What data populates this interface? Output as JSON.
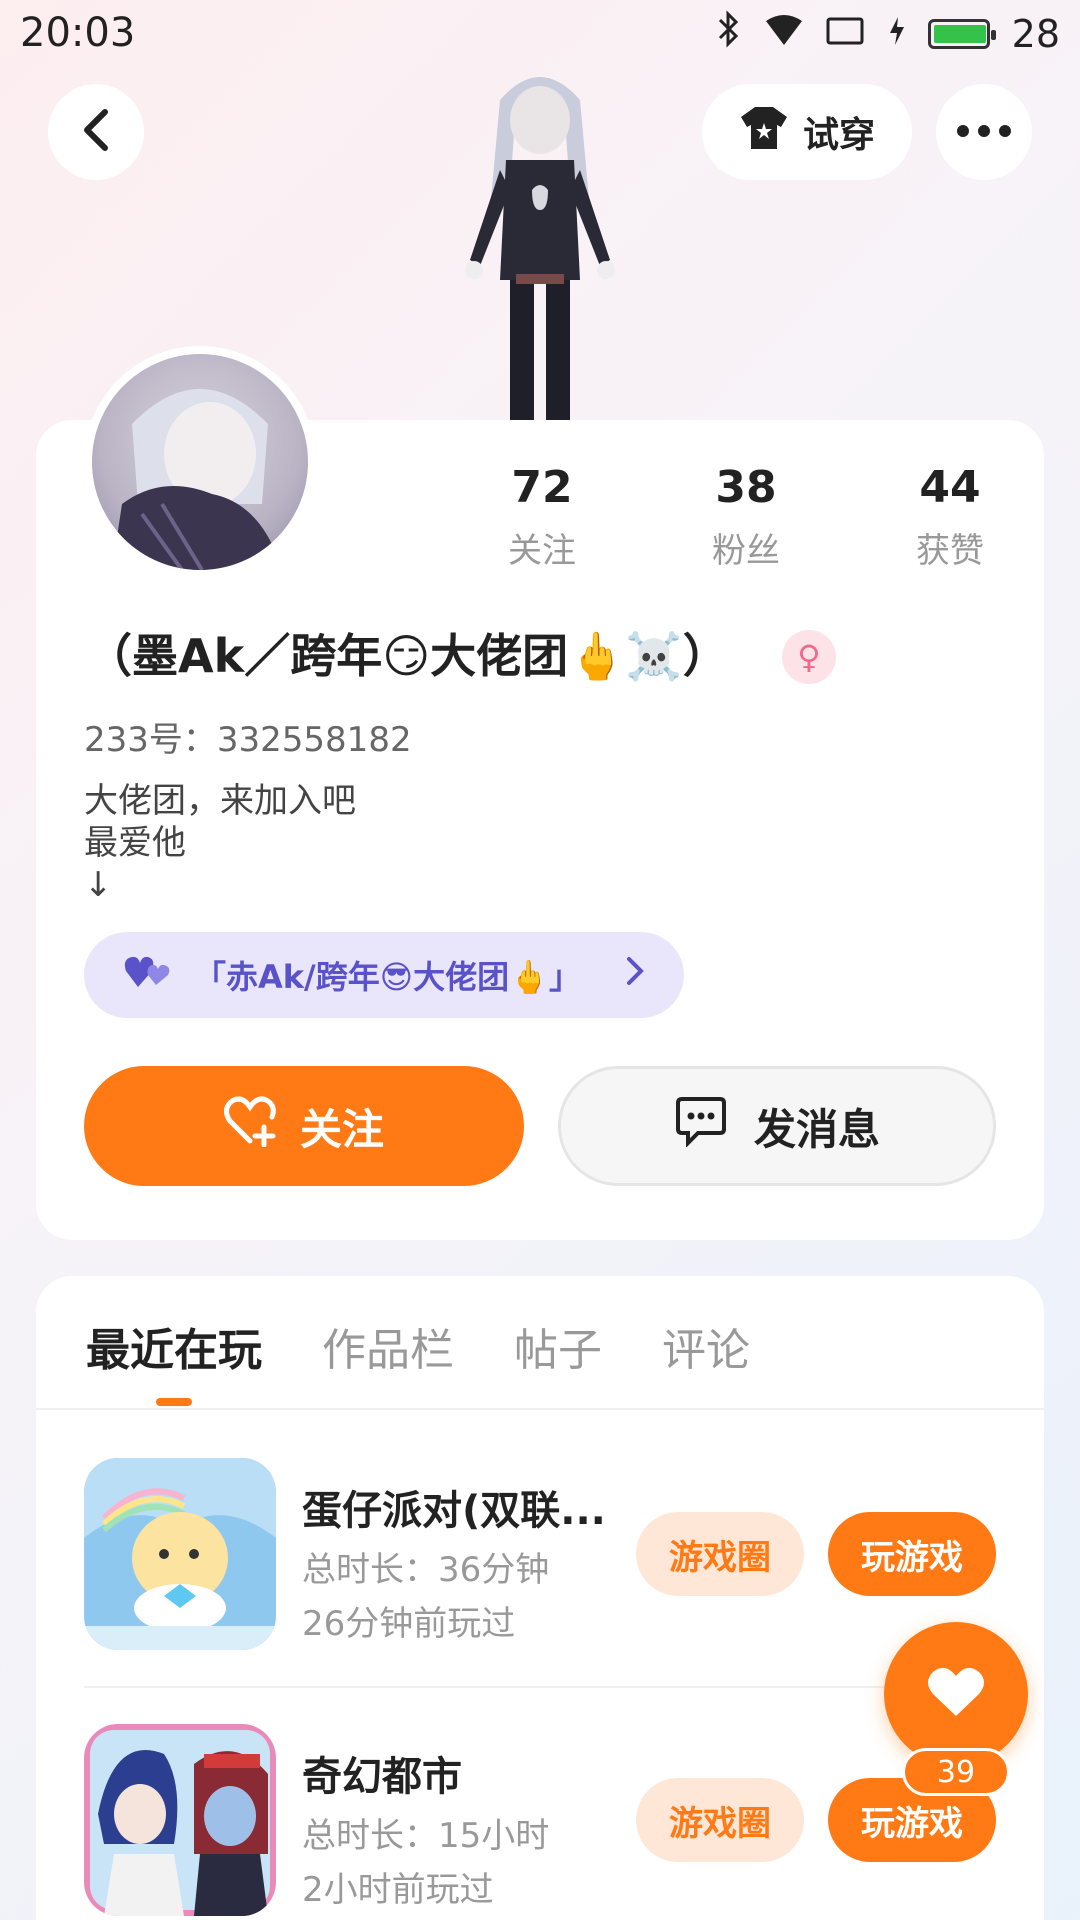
{
  "status_bar": {
    "time": "20:03",
    "battery": "28",
    "battery_level": 0.28
  },
  "nav": {
    "tryon_label": "试穿"
  },
  "profile": {
    "stats": [
      {
        "value": "72",
        "label": "关注"
      },
      {
        "value": "38",
        "label": "粉丝"
      },
      {
        "value": "44",
        "label": "获赞"
      }
    ],
    "nickname": "（墨Ak／跨年😏大佬团🖕☠️）",
    "gender_symbol": "♀",
    "user_id": "233号：332558182",
    "bio": "大佬团，来加入吧\n最爱他\n↓",
    "group_label": "「赤Ak/跨年😎大佬团🖕」",
    "follow_label": "关注",
    "message_label": "发消息"
  },
  "tabs": [
    {
      "label": "最近在玩",
      "active": true
    },
    {
      "label": "作品栏",
      "active": false
    },
    {
      "label": "帖子",
      "active": false
    },
    {
      "label": "评论",
      "active": false
    }
  ],
  "games": [
    {
      "name": "蛋仔派对(双联...",
      "duration": "总时长：36分钟",
      "last_played": "26分钟前玩过",
      "circle_label": "游戏圈",
      "play_label": "玩游戏"
    },
    {
      "name": "奇幻都市",
      "duration": "总时长：15小时",
      "last_played": "2小时前玩过",
      "circle_label": "游戏圈",
      "play_label": "玩游戏"
    }
  ],
  "like_count": "39",
  "colors": {
    "accent": "#ff7a14",
    "group_pill_bg": "#e9e6fb",
    "group_pill_text": "#5a52c9"
  }
}
